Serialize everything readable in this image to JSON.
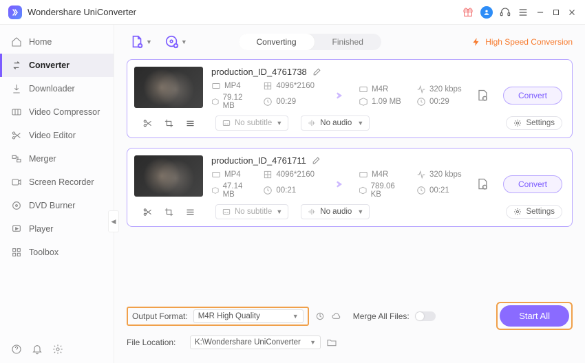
{
  "app": {
    "title": "Wondershare UniConverter"
  },
  "sidebar": {
    "items": [
      {
        "label": "Home"
      },
      {
        "label": "Converter"
      },
      {
        "label": "Downloader"
      },
      {
        "label": "Video Compressor"
      },
      {
        "label": "Video Editor"
      },
      {
        "label": "Merger"
      },
      {
        "label": "Screen Recorder"
      },
      {
        "label": "DVD Burner"
      },
      {
        "label": "Player"
      },
      {
        "label": "Toolbox"
      }
    ]
  },
  "tabs": {
    "converting": "Converting",
    "finished": "Finished"
  },
  "hsc": "High Speed Conversion",
  "subtitle_placeholder": "No subtitle",
  "audio_placeholder": "No audio",
  "settings_label": "Settings",
  "convert_label": "Convert",
  "items": [
    {
      "name": "production_ID_4761738",
      "src": {
        "fmt": "MP4",
        "res": "4096*2160",
        "size": "79.12 MB",
        "dur": "00:29"
      },
      "dst": {
        "fmt": "M4R",
        "br": "320 kbps",
        "size": "1.09 MB",
        "dur": "00:29"
      }
    },
    {
      "name": "production_ID_4761711",
      "src": {
        "fmt": "MP4",
        "res": "4096*2160",
        "size": "47.14 MB",
        "dur": "00:21"
      },
      "dst": {
        "fmt": "M4R",
        "br": "320 kbps",
        "size": "789.06 KB",
        "dur": "00:21"
      }
    }
  ],
  "footer": {
    "output_format_label": "Output Format:",
    "output_format_value": "M4R High Quality",
    "file_location_label": "File Location:",
    "file_location_value": "K:\\Wondershare UniConverter",
    "merge_label": "Merge All Files:",
    "start_all": "Start All"
  }
}
